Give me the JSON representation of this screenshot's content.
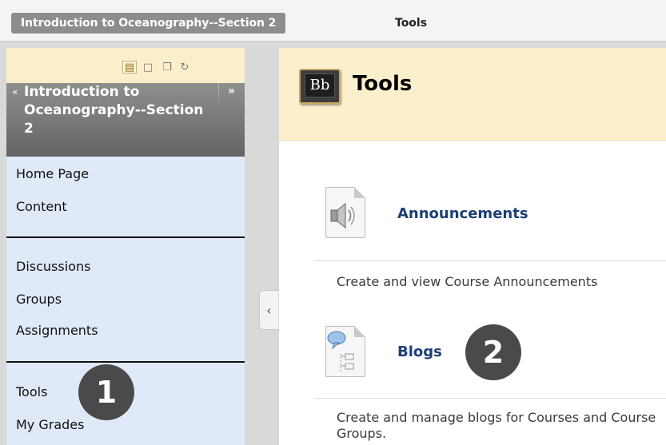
{
  "breadcrumb": {
    "course": "Introduction to Oceanography--Section 2",
    "current": "Tools"
  },
  "sidebar": {
    "toolbar_icons": [
      "list-view-icon",
      "folder-view-icon",
      "window-icon",
      "refresh-icon"
    ],
    "course_title": "Introduction to Oceanography--Section 2",
    "collapse_glyph": "«",
    "expand_glyph": "»",
    "groups": [
      {
        "items": [
          {
            "label": "Home Page"
          },
          {
            "label": "Content"
          }
        ]
      },
      {
        "items": [
          {
            "label": "Discussions"
          },
          {
            "label": "Groups"
          },
          {
            "label": "Assignments"
          }
        ]
      },
      {
        "items": [
          {
            "label": "Tools"
          },
          {
            "label": "My Grades"
          }
        ]
      }
    ]
  },
  "main": {
    "title": "Tools",
    "logo_text": "Bb",
    "tools": [
      {
        "name": "Announcements",
        "description": "Create and view Course Announcements",
        "icon": "announcement-speaker-icon"
      },
      {
        "name": "Blogs",
        "description": "Create and manage blogs for Courses and Course Groups.",
        "icon": "blog-document-icon"
      }
    ]
  },
  "callouts": [
    "1",
    "2"
  ],
  "colors": {
    "header_bg": "#fcf0cc",
    "menu_bg": "#dfe9f8",
    "link": "#1c3f75",
    "callout": "#4a4a4a"
  }
}
